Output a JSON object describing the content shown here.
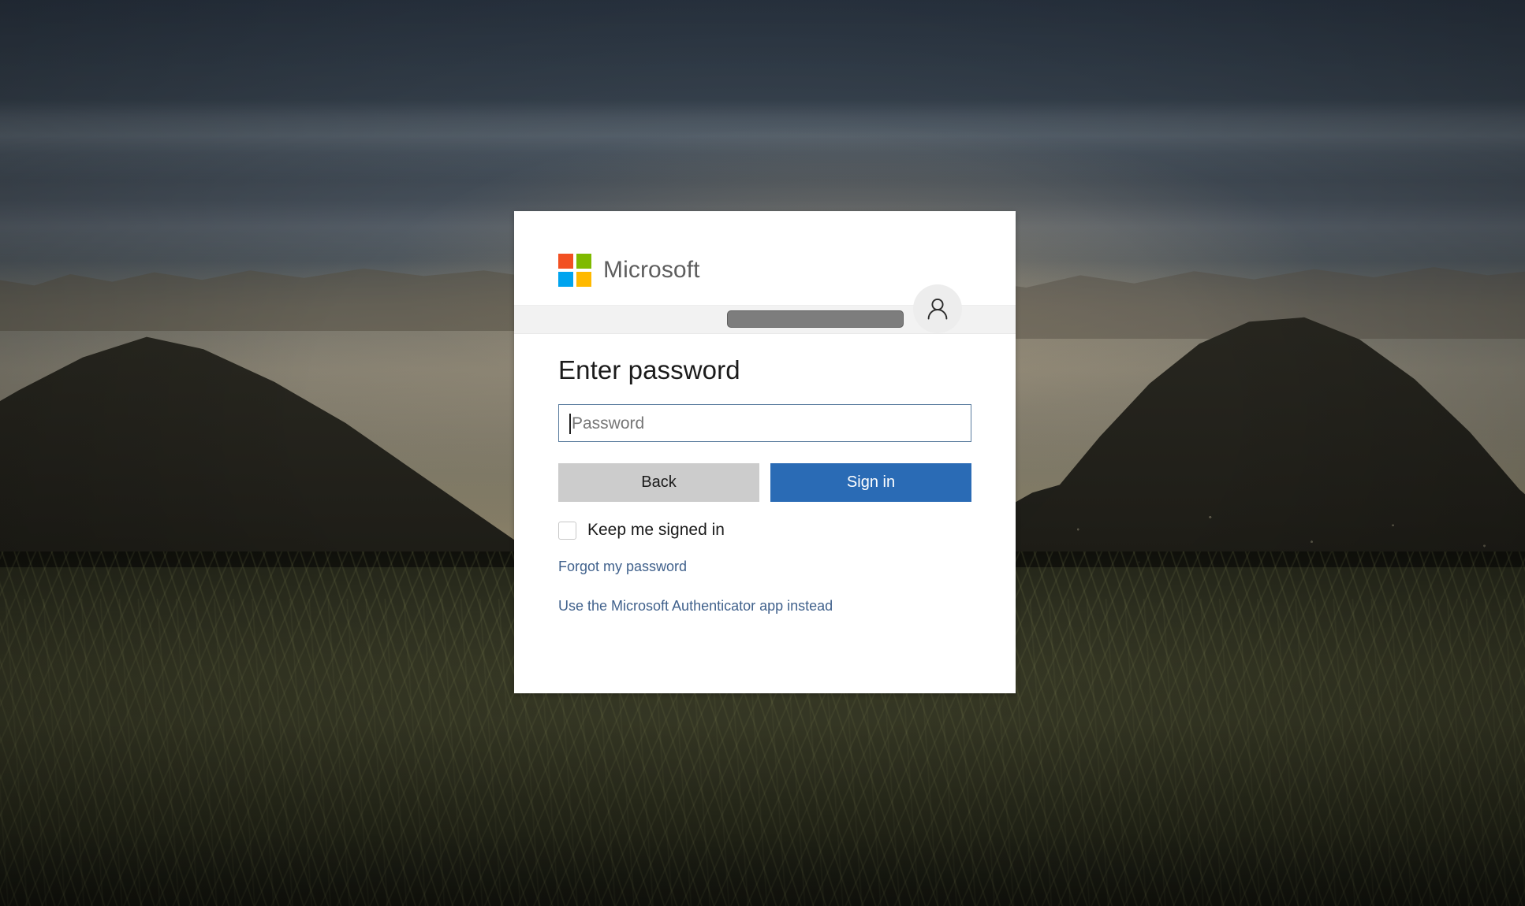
{
  "background": {
    "description": "dusk landscape photograph of a coastal city with mountains and tall grass foreground",
    "sky_top_color": "#2f3b4a",
    "horizon_color": "#9b8a6e",
    "grass_color": "#3b3d28"
  },
  "card": {
    "brand": {
      "name": "Microsoft",
      "logo_tiles": [
        {
          "name": "red-square",
          "color": "#f25022"
        },
        {
          "name": "green-square",
          "color": "#7fba00"
        },
        {
          "name": "blue-square",
          "color": "#00a4ef"
        },
        {
          "name": "yellow-square",
          "color": "#ffb900"
        }
      ]
    },
    "account_banner": {
      "account_value": "",
      "account_redacted": true,
      "avatar_icon": "person-icon"
    },
    "heading": "Enter password",
    "password_field": {
      "placeholder": "Password",
      "value": "",
      "focused": true,
      "border_color": "#5a7c9e"
    },
    "buttons": {
      "back_label": "Back",
      "back_color": "#cccccc",
      "signin_label": "Sign in",
      "signin_color": "#2a6bb5"
    },
    "keep_signed_in": {
      "label": "Keep me signed in",
      "checked": false
    },
    "links": [
      {
        "name": "forgot-password-link",
        "label": "Forgot my password"
      },
      {
        "name": "authenticator-app-link",
        "label": "Use the Microsoft Authenticator app instead"
      }
    ],
    "link_color": "#40618c"
  }
}
